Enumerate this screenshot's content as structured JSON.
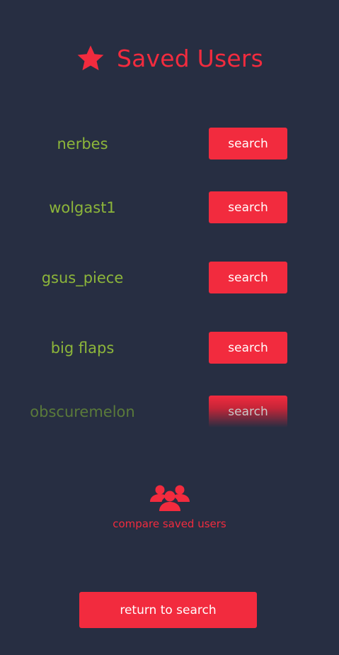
{
  "header": {
    "title": "Saved Users",
    "icon": "star-icon"
  },
  "users": [
    {
      "name": "nerbes",
      "button_label": "search"
    },
    {
      "name": "wolgast1",
      "button_label": "search"
    },
    {
      "name": "gsus_piece",
      "button_label": "search"
    },
    {
      "name": "big flaps",
      "button_label": "search"
    },
    {
      "name": "obscuremelon",
      "button_label": "search"
    }
  ],
  "compare": {
    "label": "compare saved users",
    "icon": "users-group-icon"
  },
  "footer": {
    "return_label": "return to search"
  },
  "colors": {
    "background": "#272e42",
    "accent": "#f22b3e",
    "username": "#8db63a"
  }
}
